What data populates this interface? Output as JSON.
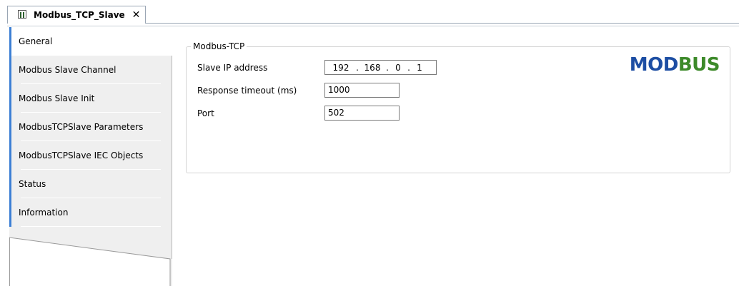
{
  "tab": {
    "title": "Modbus_TCP_Slave",
    "close_symbol": "✕",
    "icon": "device-icon"
  },
  "nav": {
    "items": [
      {
        "label": "General",
        "active": true
      },
      {
        "label": "Modbus Slave Channel",
        "active": false
      },
      {
        "label": "Modbus Slave Init",
        "active": false
      },
      {
        "label": "ModbusTCPSlave Parameters",
        "active": false
      },
      {
        "label": "ModbusTCPSlave IEC Objects",
        "active": false
      },
      {
        "label": "Status",
        "active": false
      },
      {
        "label": "Information",
        "active": false
      }
    ]
  },
  "group": {
    "title": "Modbus-TCP",
    "slave_ip_label": "Slave IP address",
    "ip": [
      "192",
      "168",
      "0",
      "1"
    ],
    "ip_separator": ".",
    "response_timeout_label": "Response timeout (ms)",
    "response_timeout_value": "1000",
    "port_label": "Port",
    "port_value": "502"
  },
  "logo": {
    "text_part1": "M",
    "text_part2": "OD",
    "text_part3": "BUS",
    "colors": {
      "blue": "#1d4ea3",
      "green": "#3d8a2a"
    }
  },
  "colors": {
    "accent": "#3c7fd4",
    "nav_background": "#efefef",
    "border": "#d4d4d4"
  }
}
